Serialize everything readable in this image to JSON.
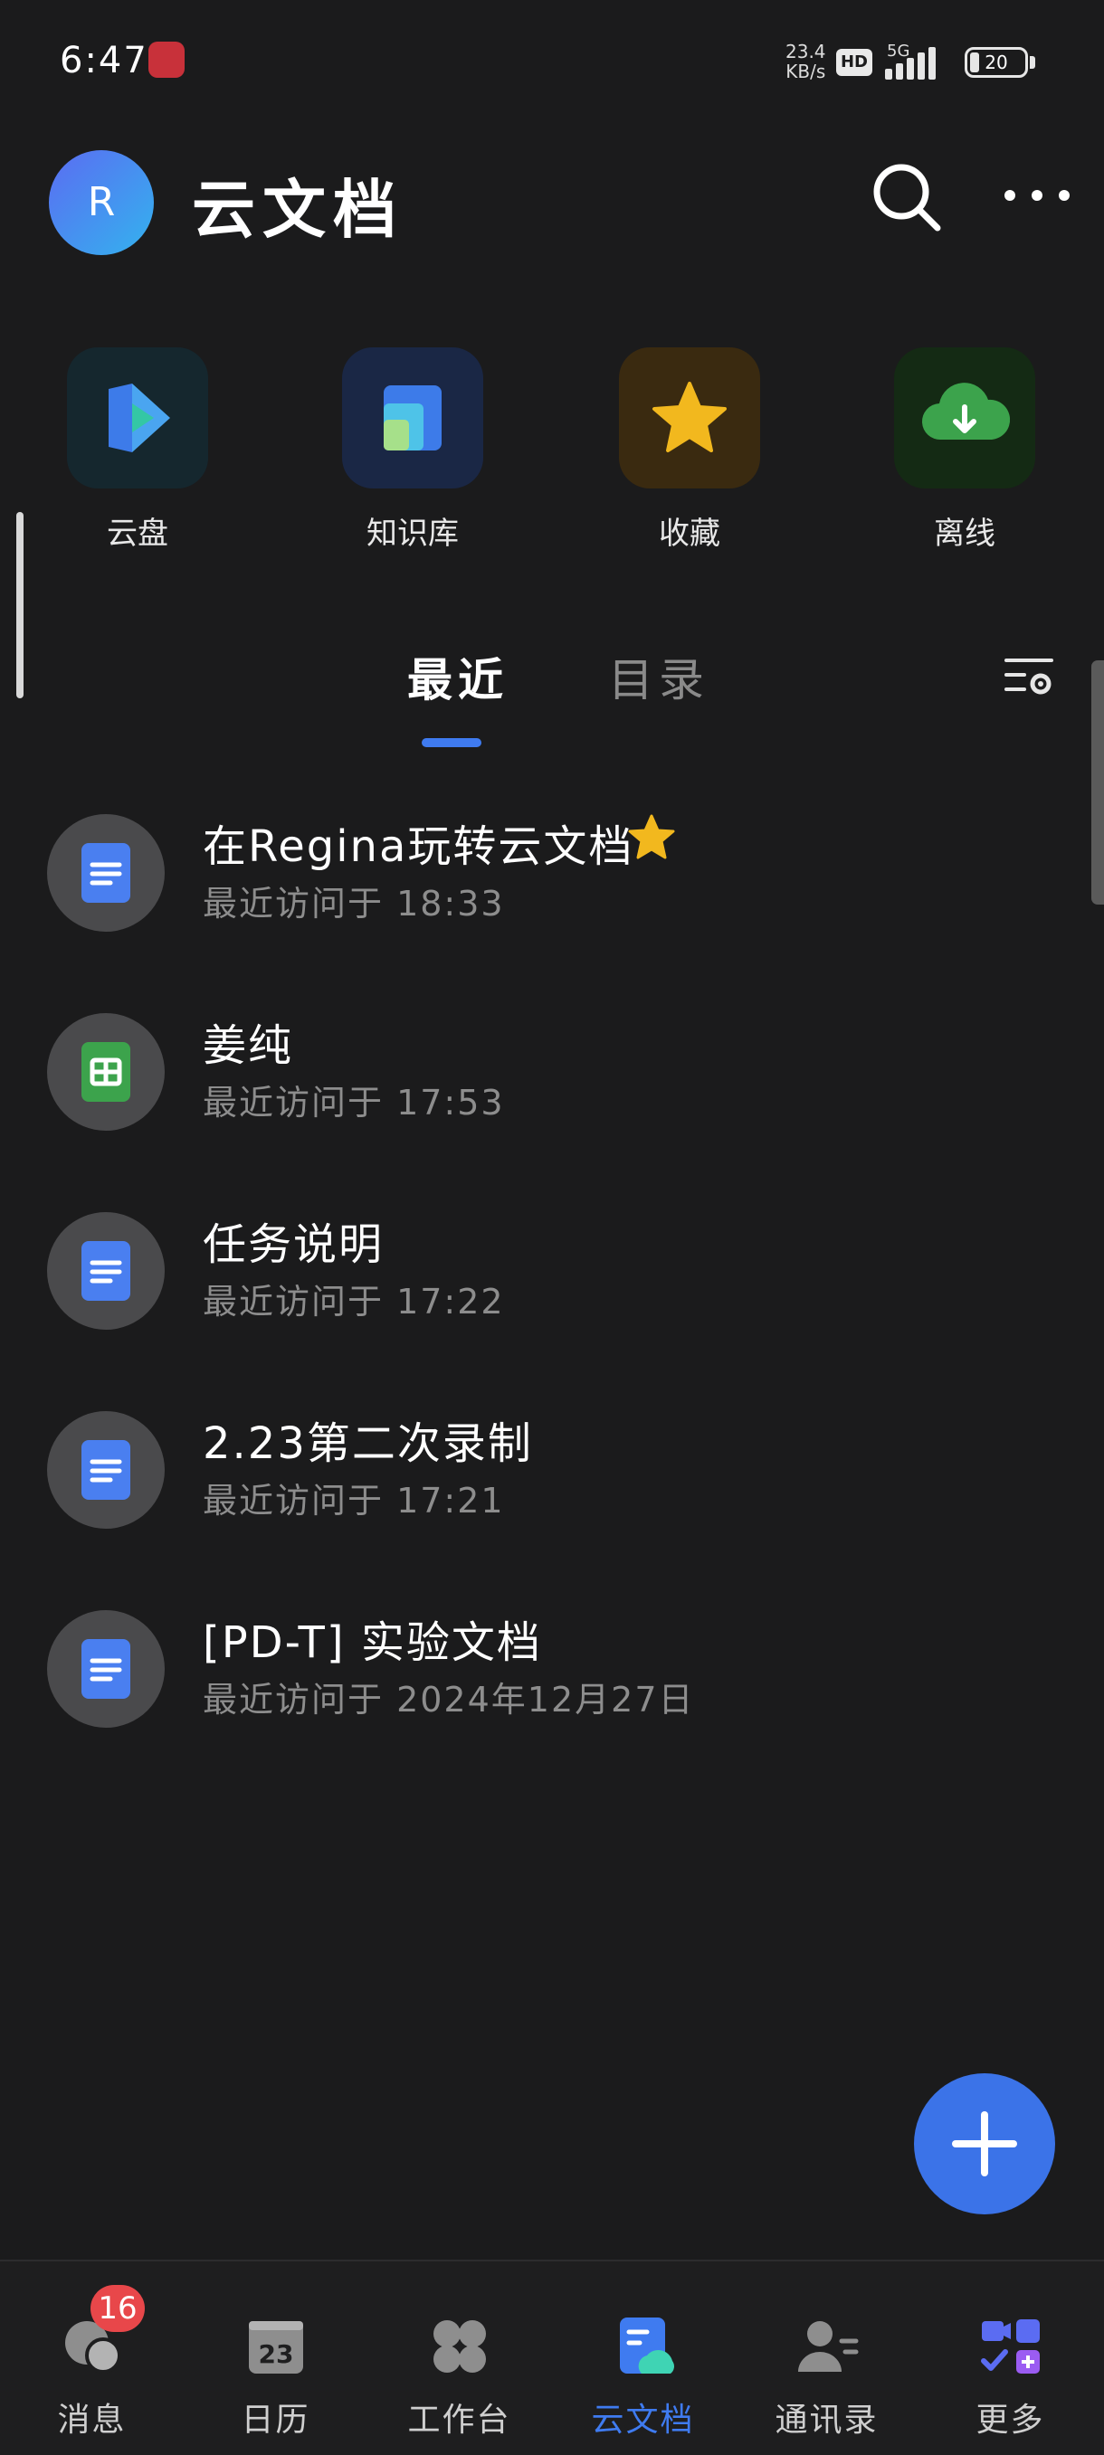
{
  "status_bar": {
    "time": "6:47",
    "net_speed_value": "23.4",
    "net_speed_unit": "KB/s",
    "hd": "HD",
    "network": "5G",
    "battery": "20"
  },
  "header": {
    "avatar_letter": "R",
    "title": "云文档"
  },
  "quick_entries": [
    {
      "label": "云盘",
      "icon": "cloud-drive-icon",
      "color": "#3d7be9"
    },
    {
      "label": "知识库",
      "icon": "knowledge-base-icon",
      "color": "#4a86ef"
    },
    {
      "label": "收藏",
      "icon": "star-icon",
      "color": "#f2b81e"
    },
    {
      "label": "离线",
      "icon": "cloud-download-icon",
      "color": "#3ca34c"
    }
  ],
  "tabs": {
    "recent": "最近",
    "directory": "目录"
  },
  "documents": [
    {
      "title": "在Regina玩转云文档",
      "time": "最近访问于 18:33",
      "type": "doc",
      "starred": true
    },
    {
      "title": "姜纯",
      "time": "最近访问于 17:53",
      "type": "sheet",
      "starred": false
    },
    {
      "title": "任务说明",
      "time": "最近访问于 17:22",
      "type": "doc",
      "starred": false
    },
    {
      "title": "2.23第二次录制",
      "time": "最近访问于 17:21",
      "type": "doc",
      "starred": false
    },
    {
      "title": "[PD-T] 实验文档",
      "time": "最近访问于 2024年12月27日",
      "type": "doc",
      "starred": false
    }
  ],
  "bottom_nav": [
    {
      "label": "消息",
      "icon": "chat-icon",
      "badge": "16"
    },
    {
      "label": "日历",
      "icon": "calendar-icon",
      "icon_text": "23"
    },
    {
      "label": "工作台",
      "icon": "workbench-icon"
    },
    {
      "label": "云文档",
      "icon": "cloud-doc-icon",
      "active": true
    },
    {
      "label": "通讯录",
      "icon": "contacts-icon"
    },
    {
      "label": "更多",
      "icon": "more-apps-icon"
    }
  ],
  "colors": {
    "background": "#1b1b1c",
    "accent": "#3f7bf0",
    "badge": "#e8474a"
  }
}
